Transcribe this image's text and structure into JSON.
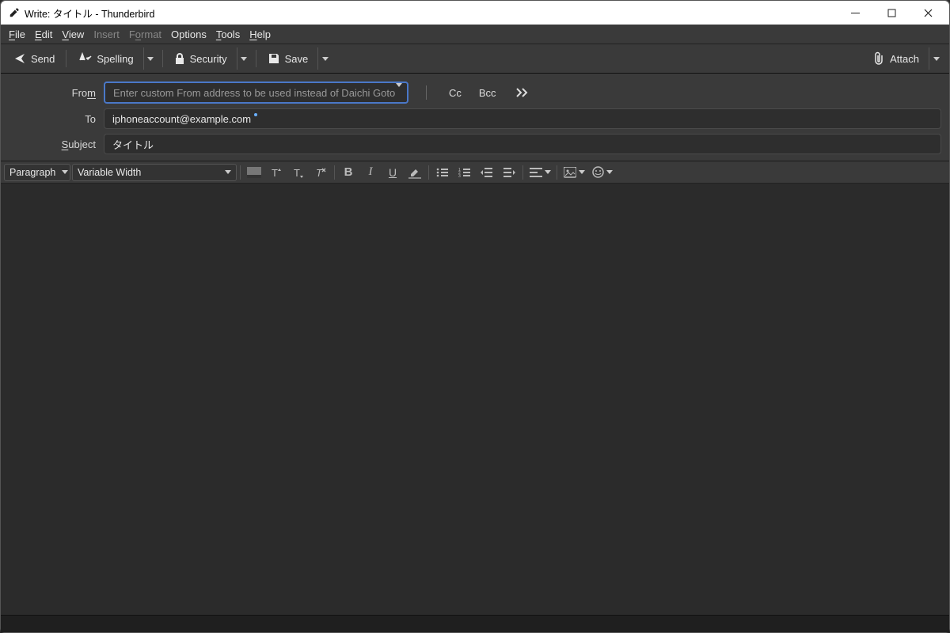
{
  "window": {
    "title": "Write: タイトル - Thunderbird"
  },
  "menu": {
    "file": "File",
    "edit": "Edit",
    "view": "View",
    "insert": "Insert",
    "format": "Format",
    "options": "Options",
    "tools": "Tools",
    "help": "Help"
  },
  "toolbar": {
    "send": "Send",
    "spelling": "Spelling",
    "security": "Security",
    "save": "Save",
    "attach": "Attach"
  },
  "headers": {
    "from_label": "From",
    "from_placeholder": "Enter custom From address to be used instead of Daichi Goto",
    "cc": "Cc",
    "bcc": "Bcc",
    "to_label": "To",
    "to_value": "iphoneaccount@example.com",
    "subject_label": "Subject",
    "subject_value": "タイトル"
  },
  "format": {
    "paragraph": "Paragraph",
    "font": "Variable Width"
  }
}
